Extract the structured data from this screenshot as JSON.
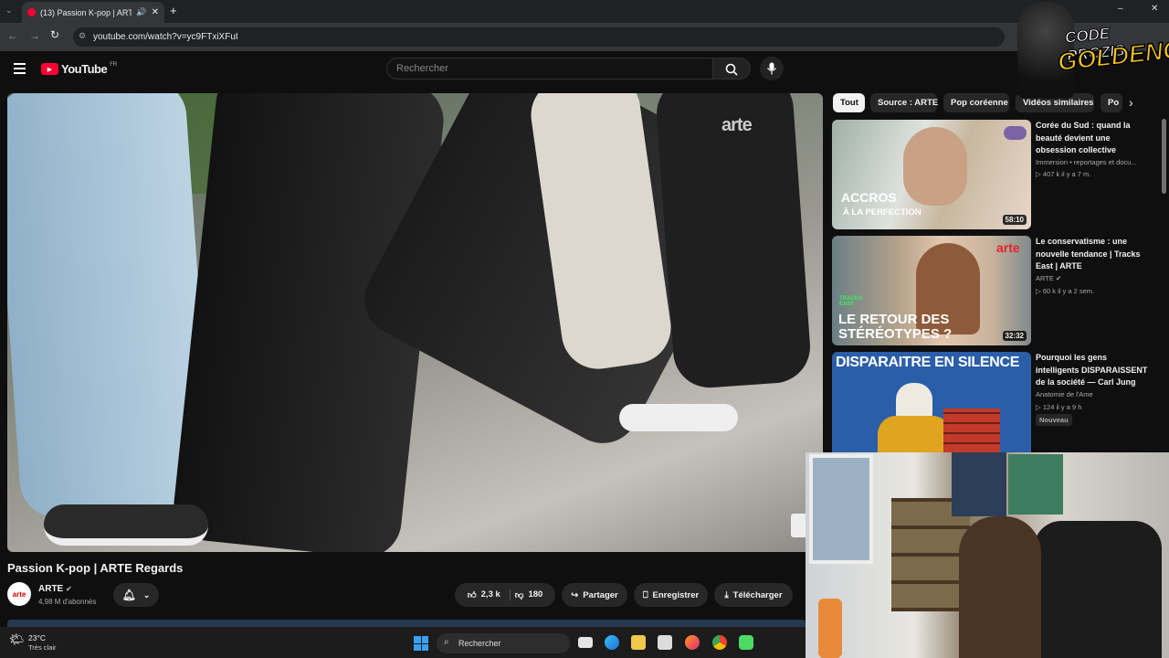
{
  "browser": {
    "tab_title": "(13) Passion K-pop | ARTE R",
    "url": "youtube.com/watch?v=yc9FTxiXFuI"
  },
  "youtube": {
    "brand": "YouTube",
    "country": "FR",
    "search_placeholder": "Rechercher"
  },
  "video": {
    "watermark": "arte",
    "title": "Passion K-pop | ARTE Regards",
    "channel": {
      "name": "ARTE",
      "avatar_text": "arte",
      "subscribers": "4,98 M d'abonnés"
    },
    "actions": {
      "likes": "2,3 k",
      "dislikes": "180",
      "share": "Partager",
      "save": "Enregistrer",
      "download": "Télécharger"
    }
  },
  "chips": [
    "Tout",
    "Source : ARTE",
    "Pop coréenne",
    "Vidéos similaires",
    "Po"
  ],
  "recommendations": [
    {
      "title": "Corée du Sud : quand la beauté devient une obsession collective",
      "channel": "Immersion • reportages et docu...",
      "meta": "▷ 407 k  il y a 7 m.",
      "duration": "58:10",
      "thumb_line1": "ACCROS",
      "thumb_line2": "À LA PERFECTION"
    },
    {
      "title": "Le conservatisme : une nouvelle tendance | Tracks East | ARTE",
      "channel": "ARTE",
      "meta": "▷ 60 k  il y a 2 sem.",
      "duration": "32:32",
      "thumb_line1": "LE RETOUR DES",
      "thumb_line2": "STÉRÉOTYPES ?",
      "thumb_tag": "TRACKS EAST",
      "thumb_logo": "arte"
    },
    {
      "title": "Pourquoi les gens intelligents DISPARAISSENT de la société — Carl Jung",
      "channel": "Anatomie de l'Ame",
      "meta": "▷ 124  il y a 9 h",
      "badge": "Nouveau",
      "thumb_line1": "DISPARAITRE EN SILENCE"
    }
  ],
  "taskbar": {
    "temperature": "23°C",
    "weather": "Très clair",
    "search": "Rechercher"
  },
  "overlay_logo": {
    "line1": "CODE PROZIS",
    "line2": "GOLDENG"
  },
  "colors": {
    "background": "#0f0f0f",
    "youtube_red": "#ff0033",
    "chip_active": "#f1f1f1",
    "logo_gold": "#f5c518"
  }
}
